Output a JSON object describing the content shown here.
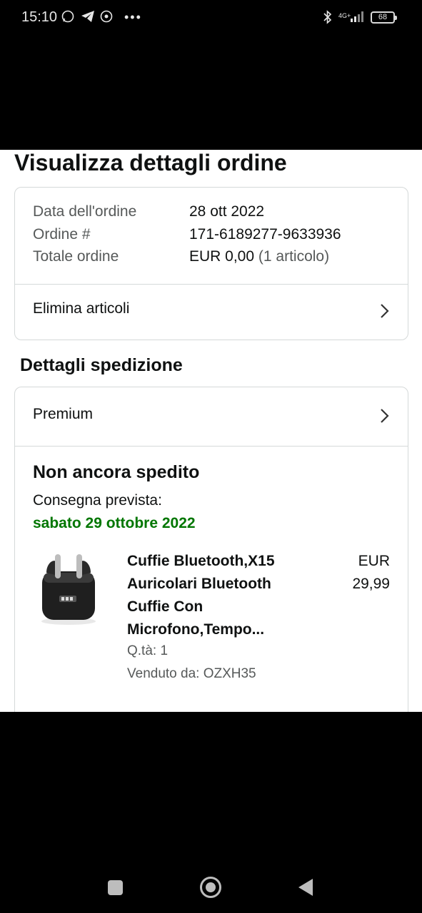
{
  "status_bar": {
    "time": "15:10",
    "network": "4G+",
    "battery": "68"
  },
  "page": {
    "title": "Visualizza dettagli ordine"
  },
  "order_summary": {
    "date_label": "Data dell'ordine",
    "date_value": "28 ott 2022",
    "order_label": "Ordine #",
    "order_value": "171-6189277-9633936",
    "total_label": "Totale ordine",
    "total_value": "EUR 0,00",
    "total_items": "(1 articolo)",
    "remove_items_label": "Elimina articoli"
  },
  "shipping": {
    "section_title": "Dettagli spedizione",
    "method": "Premium",
    "status": "Non ancora spedito",
    "delivery_label": "Consegna prevista:",
    "delivery_date": "sabato 29 ottobre 2022"
  },
  "product": {
    "title": "Cuffie Bluetooth,X15 Auricolari Bluetooth Cuffie Con Microfono,Tempo...",
    "price_currency": "EUR",
    "price_amount": "29,99",
    "quantity": "Q.tà: 1",
    "seller": "Venduto da: OZXH35"
  },
  "colors": {
    "delivery_green": "#007600",
    "border": "#d5d9d9",
    "muted_text": "#565959"
  }
}
